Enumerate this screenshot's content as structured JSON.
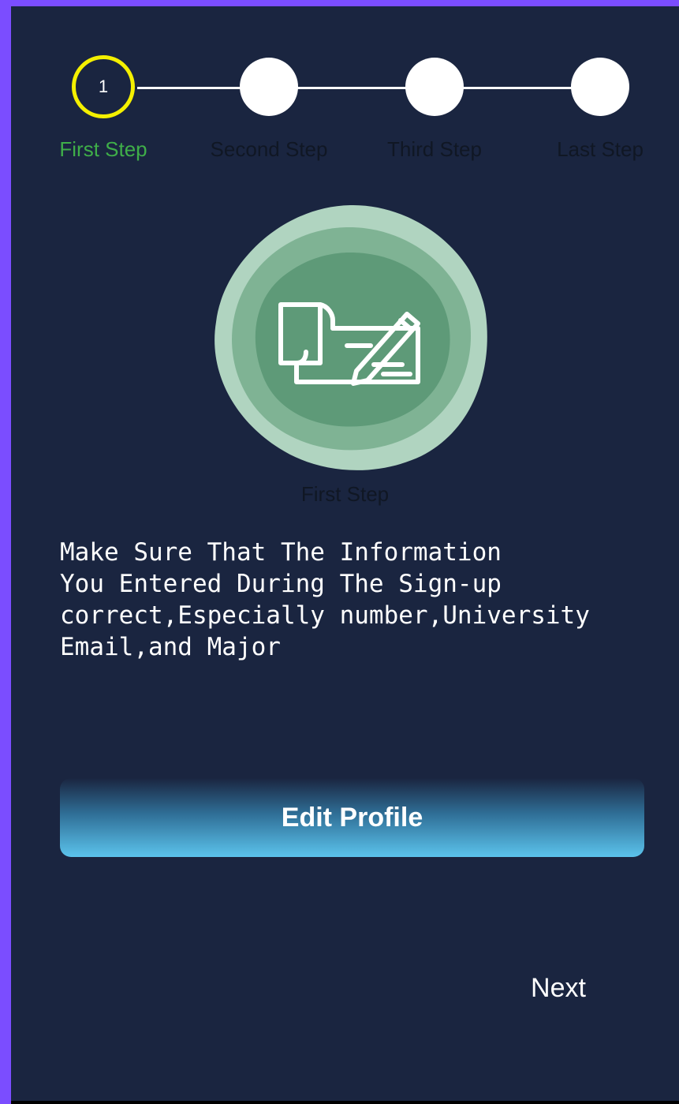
{
  "stepper": {
    "steps": [
      {
        "number": "1",
        "label": "First Step"
      },
      {
        "number": "",
        "label": "Second Step"
      },
      {
        "number": "",
        "label": "Third Step"
      },
      {
        "number": "",
        "label": "Last Step"
      }
    ],
    "active_index": 0,
    "colors": {
      "active_ring": "#f4f000",
      "active_label": "#3fae49",
      "inactive_label": "#101724",
      "circle": "#ffffff"
    }
  },
  "illustration": {
    "icon": "document-edit-icon",
    "caption": "First Step",
    "colors": {
      "outer": "#b0d4c0",
      "mid": "#7fb394",
      "inner": "#5e9a78"
    }
  },
  "info": {
    "text": "Make Sure That The Information\nYou Entered During The Sign-up\ncorrect,Especially number,University\nEmail,and Major"
  },
  "actions": {
    "edit_profile_label": "Edit Profile",
    "next_label": "Next"
  },
  "theme": {
    "background": "#1a2540",
    "frame": "#7b4dff"
  }
}
